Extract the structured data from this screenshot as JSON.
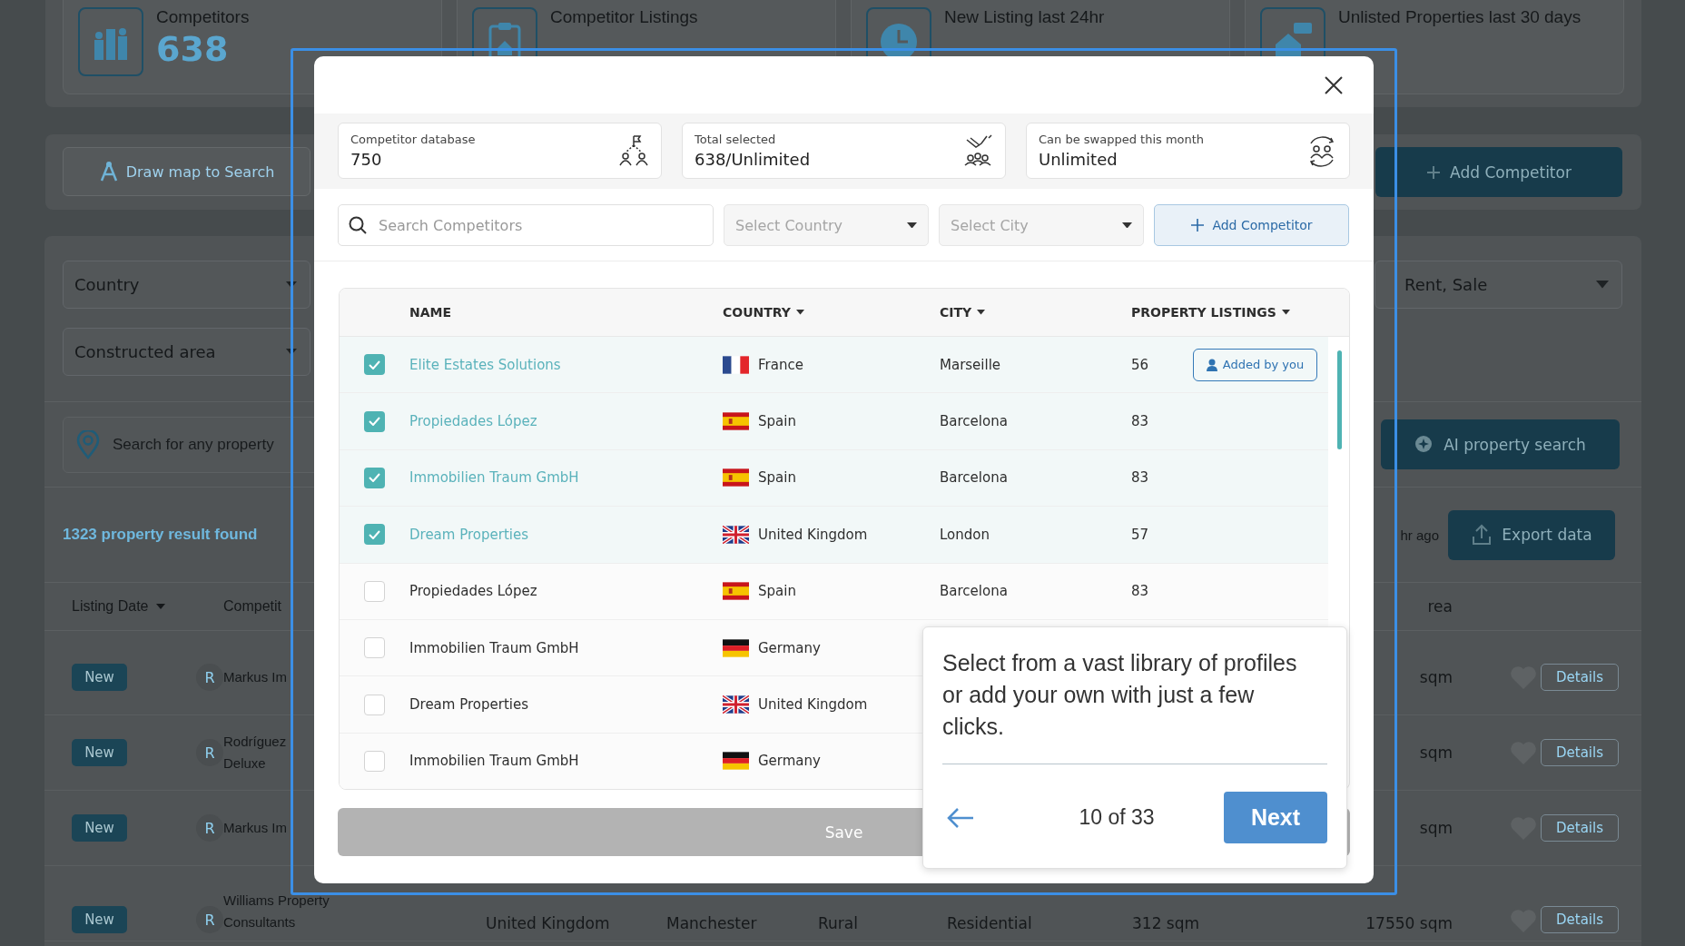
{
  "dashboard": {
    "stats": [
      {
        "label": "Competitors",
        "value": "638"
      },
      {
        "label": "Competitor Listings"
      },
      {
        "label": "New Listing last 24hr"
      },
      {
        "label": "Unlisted Properties last 30 days"
      }
    ],
    "draw_map_button": "Draw map to Search",
    "add_competitor_button": "Add Competitor",
    "filters": [
      {
        "label": "Country"
      },
      {
        "label": "Constructed area"
      }
    ],
    "transaction_filter": "Rent, Sale",
    "search_placeholder": "Search for any property",
    "ai_search_button": "AI property search",
    "results_count": "1323 property result found",
    "updated": "hr ago",
    "export_button": "Export data",
    "columns": [
      {
        "label": "Listing Date",
        "sortable": true
      },
      {
        "label": "Competit",
        "sortable": false
      }
    ],
    "area_column": "rea",
    "rows": [
      {
        "badge": "New",
        "avatar": "R",
        "name": "Markus Im",
        "area": "sqm",
        "action": "Details"
      },
      {
        "badge": "New",
        "avatar": "R",
        "name": "Rodríguez Deluxe",
        "area": "sqm",
        "action": "Details"
      },
      {
        "badge": "New",
        "avatar": "R",
        "name": "Markus Im",
        "area": "sqm",
        "action": "Details"
      },
      {
        "badge": "New",
        "avatar": "R",
        "name": "Williams Property Consultants",
        "country": "United Kingdom",
        "city": "Manchester",
        "type": "Rural",
        "category": "Residential",
        "size": "312 sqm",
        "area": "17550 sqm",
        "action": "Details"
      }
    ]
  },
  "modal": {
    "stats": [
      {
        "label": "Competitor database",
        "value": "750"
      },
      {
        "label": "Total selected",
        "value": "638/Unlimited"
      },
      {
        "label": "Can be swapped this month",
        "value": "Unlimited"
      }
    ],
    "search_placeholder": "Search Competitors",
    "country_select": "Select Country",
    "city_select": "Select City",
    "add_button": "Add Competitor",
    "columns": [
      {
        "label": "NAME",
        "sortable": false
      },
      {
        "label": "COUNTRY",
        "sortable": true
      },
      {
        "label": "CITY",
        "sortable": true
      },
      {
        "label": "PROPERTY LISTINGS",
        "sortable": true
      }
    ],
    "rows": [
      {
        "checked": true,
        "name": "Elite Estates Solutions",
        "kind": "fr",
        "country": "France",
        "city": "Marseille",
        "listings": "56",
        "badge": "Added by you"
      },
      {
        "checked": true,
        "name": "Propiedades López",
        "kind": "es",
        "country": "Spain",
        "city": "Barcelona",
        "listings": "83"
      },
      {
        "checked": true,
        "name": "Immobilien Traum GmbH",
        "kind": "es",
        "country": "Spain",
        "city": "Barcelona",
        "listings": "83"
      },
      {
        "checked": true,
        "name": "Dream Properties",
        "kind": "gb",
        "country": "United Kingdom",
        "city": "London",
        "listings": "57"
      },
      {
        "checked": false,
        "name": "Propiedades López",
        "kind": "es",
        "country": "Spain",
        "city": "Barcelona",
        "listings": "83"
      },
      {
        "checked": false,
        "name": "Immobilien Traum GmbH",
        "kind": "de",
        "country": "Germany"
      },
      {
        "checked": false,
        "name": "Dream Properties",
        "kind": "gb",
        "country": "United Kingdom"
      },
      {
        "checked": false,
        "name": "Immobilien Traum GmbH",
        "kind": "de",
        "country": "Germany"
      }
    ],
    "save_button": {
      "label": "Save",
      "disabled": true
    }
  },
  "tour": {
    "text": "Select from a vast library of profiles or add your own with just a few clicks.",
    "progress": "10 of 33",
    "next_button": "Next"
  }
}
